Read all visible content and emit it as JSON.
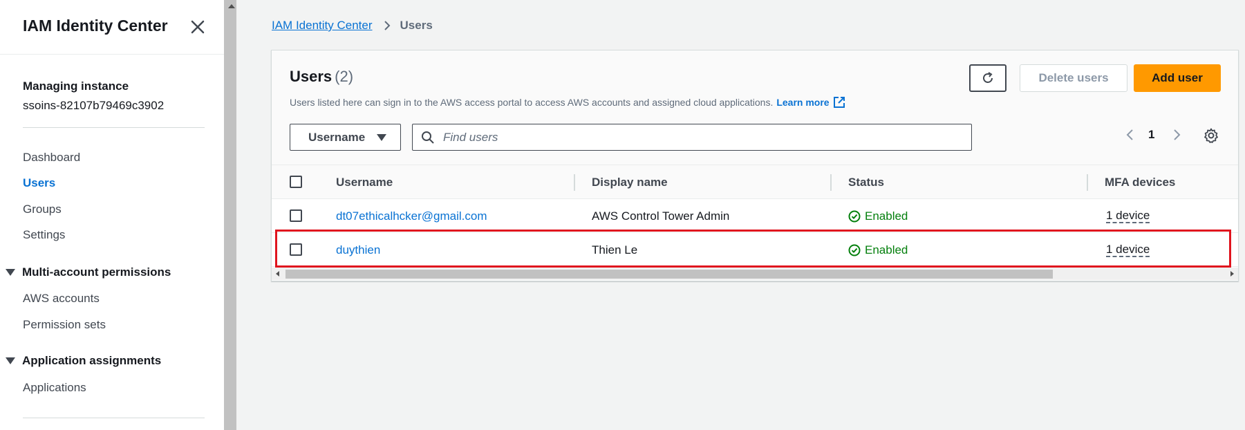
{
  "sidebar": {
    "title": "IAM Identity Center",
    "instance_label": "Managing instance",
    "instance_value": "ssoins-82107b79469c3902",
    "links": [
      "Dashboard",
      "Users",
      "Groups",
      "Settings"
    ],
    "active_link": "Users",
    "sections": [
      {
        "label": "Multi-account permissions",
        "items": [
          "AWS accounts",
          "Permission sets"
        ]
      },
      {
        "label": "Application assignments",
        "items": [
          "Applications"
        ]
      }
    ]
  },
  "breadcrumb": {
    "root": "IAM Identity Center",
    "current": "Users"
  },
  "panel": {
    "title": "Users",
    "count": "(2)",
    "description": "Users listed here can sign in to the AWS access portal to access AWS accounts and assigned cloud applications.",
    "learn_more": "Learn more",
    "delete_label": "Delete users",
    "add_label": "Add user",
    "filter_property": "Username",
    "search_placeholder": "Find users",
    "page": "1"
  },
  "table": {
    "columns": [
      "Username",
      "Display name",
      "Status",
      "MFA devices"
    ],
    "rows": [
      {
        "username": "dt07ethicalhcker@gmail.com",
        "display_name": "AWS Control Tower Admin",
        "status": "Enabled",
        "mfa": "1 device"
      },
      {
        "username": "duythien",
        "display_name": "Thien Le",
        "status": "Enabled",
        "mfa": "1 device"
      }
    ],
    "highlighted_row": "duythien"
  },
  "icons": {
    "close": "close-icon",
    "breadcrumb_sep": "chevron-right-icon",
    "refresh": "refresh-icon",
    "external": "external-link-icon",
    "search": "search-icon",
    "prev": "chevron-left-icon",
    "next": "chevron-right-icon",
    "settings": "gear-icon",
    "status": "check-circle-icon"
  },
  "colors": {
    "link": "#0972d3",
    "primary_button": "#ff9900",
    "status_success": "#037f0c",
    "highlight_border": "#e0141e"
  }
}
